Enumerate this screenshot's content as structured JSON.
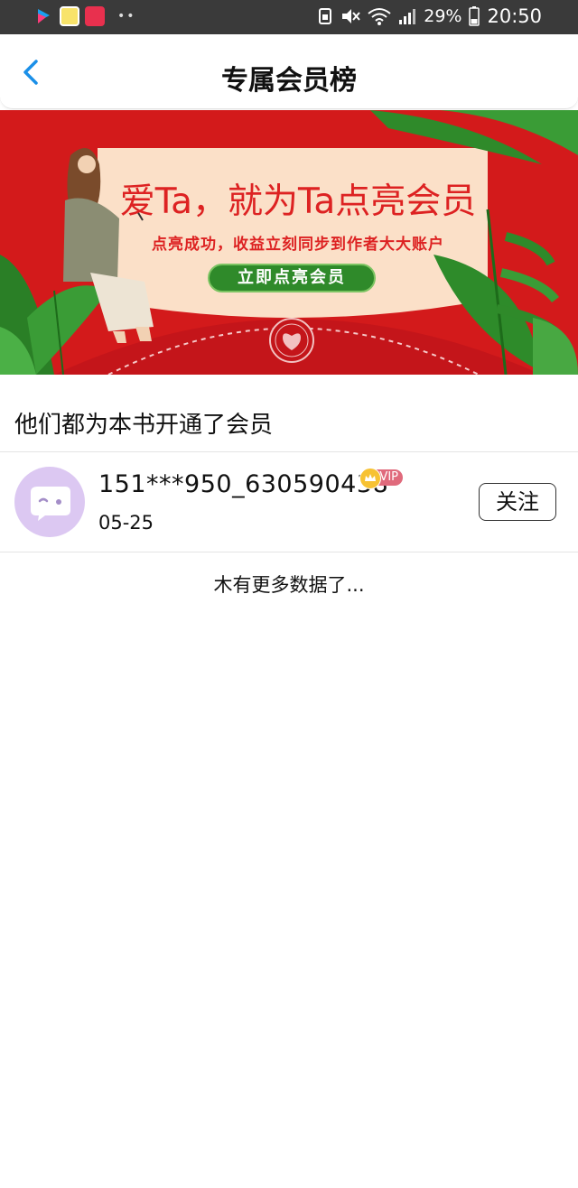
{
  "status_bar": {
    "battery": "29%",
    "time": "20:50"
  },
  "nav": {
    "title": "专属会员榜"
  },
  "banner": {
    "headline": "爱Ta，就为Ta点亮会员",
    "subline": "点亮成功，收益立刻同步到作者大大账户",
    "button": "立即点亮会员"
  },
  "section": {
    "title": "他们都为本书开通了会员"
  },
  "members": [
    {
      "name": "151***950_630590438",
      "badge": "VIP",
      "date": "05-25",
      "action": "关注"
    }
  ],
  "footer": {
    "no_more": "木有更多数据了..."
  },
  "colors": {
    "accent": "#1a8fe8",
    "banner_red": "#d31a1b",
    "banner_green": "#2f8a2a",
    "avatar_bg": "#dcc8f2"
  }
}
